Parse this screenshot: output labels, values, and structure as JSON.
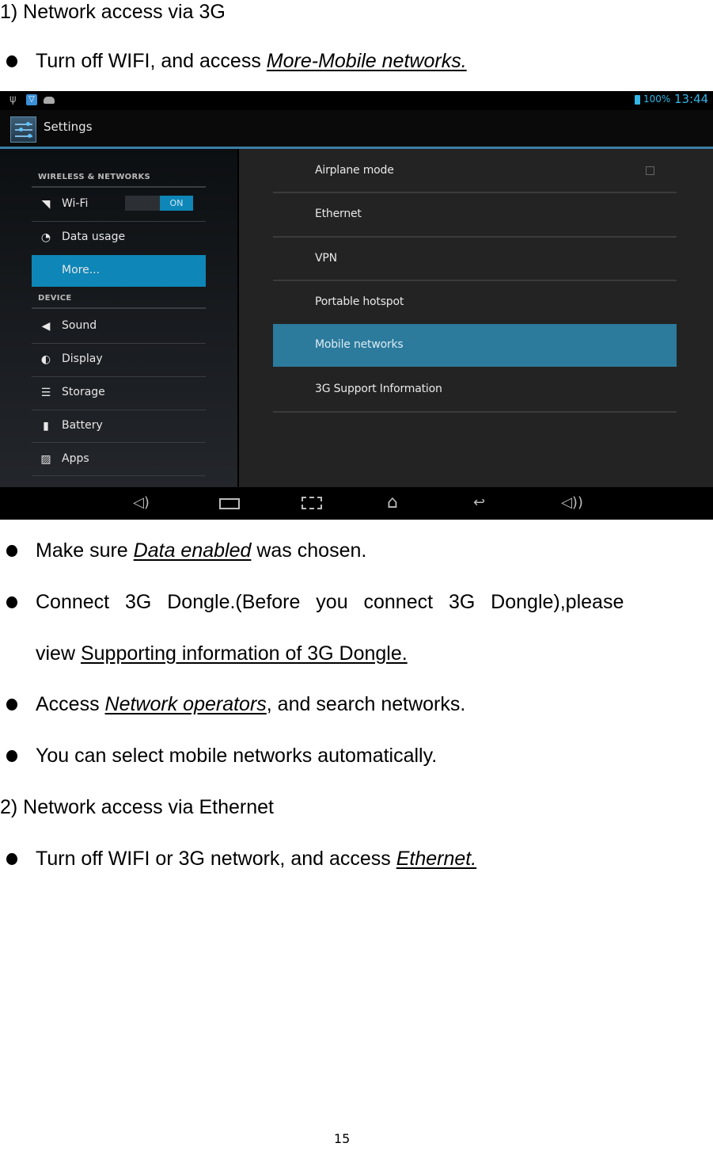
{
  "document": {
    "heading_1": "1) Network access via 3G",
    "bullets_1": [
      {
        "prefix": "Turn off WIFI, and access ",
        "link": "More-Mobile networks.",
        "suffix": ""
      }
    ],
    "bullets_2": [
      {
        "prefix": "Make sure ",
        "link": "Data enabled",
        "suffix": " was chosen."
      },
      {
        "line1": "Connect  3G  Dongle.(Before  you  connect  3G  Dongle),please",
        "line2_prefix": "view ",
        "line2_link": "Supporting information of 3G Dongle."
      },
      {
        "prefix": "Access ",
        "link": "Network operators",
        "suffix": ", and search networks."
      },
      {
        "text": "You can select mobile networks automatically."
      }
    ],
    "heading_2": "2) Network access via Ethernet",
    "bullets_3": [
      {
        "prefix": "Turn off WIFI or 3G network, and access ",
        "link": "Ethernet.",
        "suffix": ""
      }
    ],
    "page_number": "15"
  },
  "screenshot": {
    "status_bar": {
      "icons": [
        "usb-icon",
        "shield-notification-icon",
        "android-notification-icon"
      ],
      "battery_icon": "battery-charging-icon",
      "battery_percent": "100%",
      "time": "13:44"
    },
    "action_bar": {
      "app_icon": "settings-sliders-icon",
      "title": "Settings"
    },
    "sidebar": {
      "sections": [
        {
          "header": "WIRELESS & NETWORKS",
          "items": [
            {
              "label": "Wi-Fi",
              "icon": "wifi-icon",
              "toggle": "ON"
            },
            {
              "label": "Data usage",
              "icon": "data-usage-icon"
            },
            {
              "label": "More...",
              "icon": "",
              "selected": true
            }
          ]
        },
        {
          "header": "DEVICE",
          "items": [
            {
              "label": "Sound",
              "icon": "sound-icon"
            },
            {
              "label": "Display",
              "icon": "display-icon"
            },
            {
              "label": "Storage",
              "icon": "storage-icon"
            },
            {
              "label": "Battery",
              "icon": "battery-icon"
            },
            {
              "label": "Apps",
              "icon": "apps-icon"
            }
          ]
        }
      ]
    },
    "detail": {
      "items": [
        {
          "label": "Airplane mode",
          "checkbox": false
        },
        {
          "label": "Ethernet"
        },
        {
          "label": "VPN"
        },
        {
          "label": "Portable hotspot"
        },
        {
          "label": "Mobile networks",
          "selected": true
        },
        {
          "label": "3G Support Information"
        }
      ]
    },
    "nav_bar": {
      "buttons": [
        "volume-down-icon",
        "recent-apps-icon",
        "screenshot-icon",
        "home-icon",
        "back-icon",
        "volume-up-icon"
      ]
    },
    "colors": {
      "accent": "#33b5e5",
      "selected_sidebar": "#0e86b8",
      "selected_detail": "#2c7a9c",
      "action_bar_rule": "#3c7fa6"
    }
  }
}
